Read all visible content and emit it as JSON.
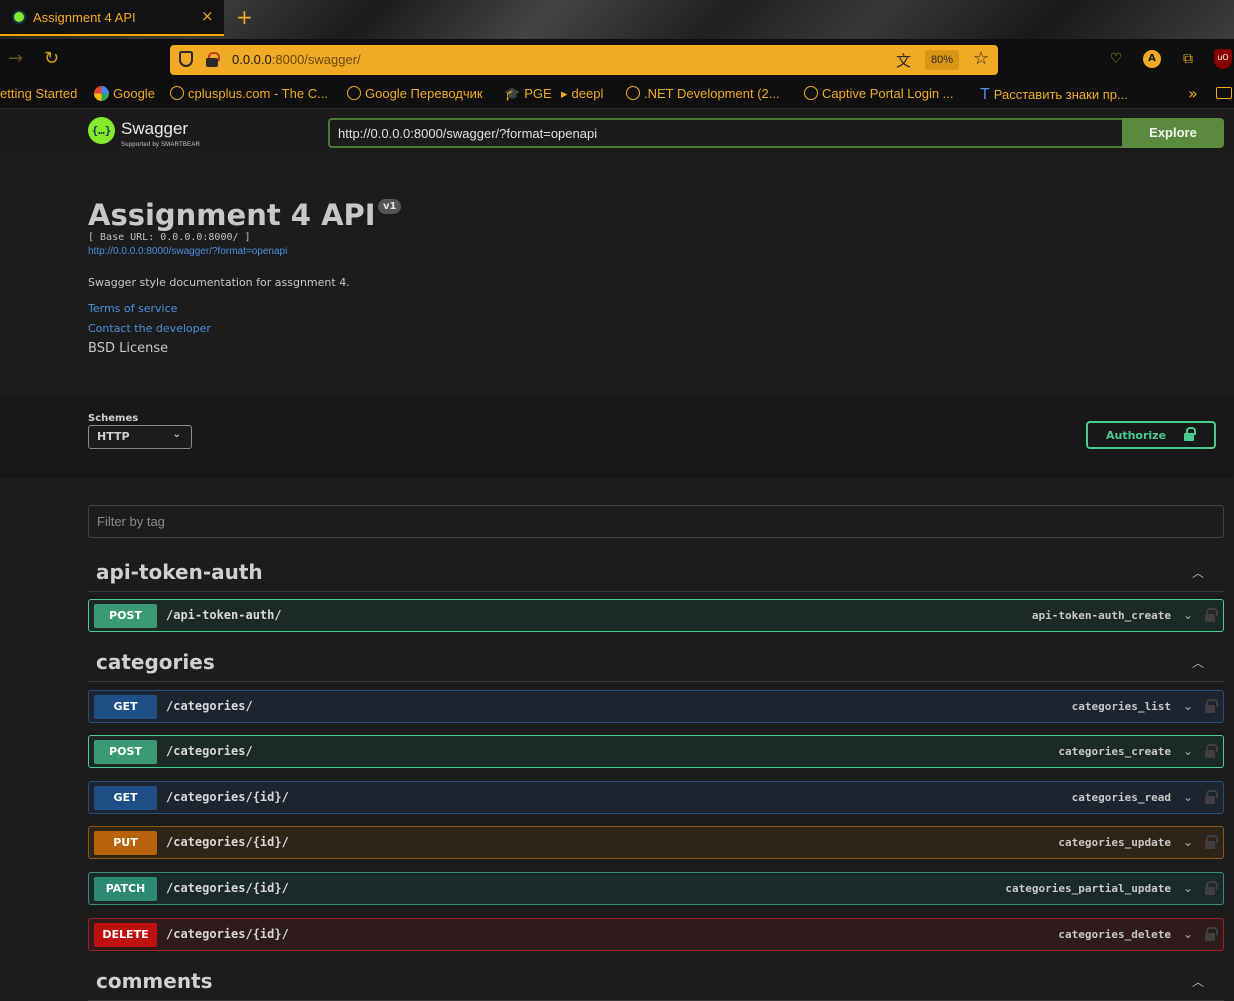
{
  "browser": {
    "tab_title": "Assignment 4 API",
    "tab_close": "×",
    "new_tab": "+",
    "url_host": "0.0.0.0",
    "url_path": ":8000/swagger/",
    "zoom": "80%",
    "avatar_letter": "A",
    "ublock_label": "uO",
    "bookmarks": [
      "etting Started",
      "Google",
      "cplusplus.com - The C...",
      "Google Переводчик",
      "PGE",
      "deepl",
      ".NET Development (2...",
      "Captive Portal Login ...",
      "Расставить знаки пр..."
    ]
  },
  "swagger": {
    "logo_text": "Swagger",
    "logo_sub": "Supported by SMARTBEAR",
    "spec_url": "http://0.0.0.0:8000/swagger/?format=openapi",
    "explore_label": "Explore"
  },
  "info": {
    "title": "Assignment 4 API",
    "version": "v1",
    "base_url": "[ Base URL: 0.0.0.0:8000/ ]",
    "spec_link": "http://0.0.0.0:8000/swagger/?format=openapi",
    "description": "Swagger style documentation for assgnment 4.",
    "terms": "Terms of service",
    "contact": "Contact the developer",
    "license": "BSD License"
  },
  "schemes": {
    "label": "Schemes",
    "selected": "HTTP",
    "authorize_label": "Authorize"
  },
  "filter_placeholder": "Filter by tag",
  "tags": [
    {
      "name": "api-token-auth",
      "operations": [
        {
          "method": "POST",
          "path": "/api-token-auth/",
          "operation_id": "api-token-auth_create"
        }
      ]
    },
    {
      "name": "categories",
      "operations": [
        {
          "method": "GET",
          "path": "/categories/",
          "operation_id": "categories_list"
        },
        {
          "method": "POST",
          "path": "/categories/",
          "operation_id": "categories_create"
        },
        {
          "method": "GET",
          "path": "/categories/{id}/",
          "operation_id": "categories_read"
        },
        {
          "method": "PUT",
          "path": "/categories/{id}/",
          "operation_id": "categories_update"
        },
        {
          "method": "PATCH",
          "path": "/categories/{id}/",
          "operation_id": "categories_partial_update"
        },
        {
          "method": "DELETE",
          "path": "/categories/{id}/",
          "operation_id": "categories_delete"
        }
      ]
    },
    {
      "name": "comments",
      "operations": []
    }
  ],
  "colors": {
    "accent": "#f0aa24",
    "swagger_green": "#85ea2d",
    "post": "#49cc90",
    "get": "#1d4f86",
    "put": "#b8630b",
    "patch": "#2d8a72",
    "delete": "#bf1010"
  }
}
